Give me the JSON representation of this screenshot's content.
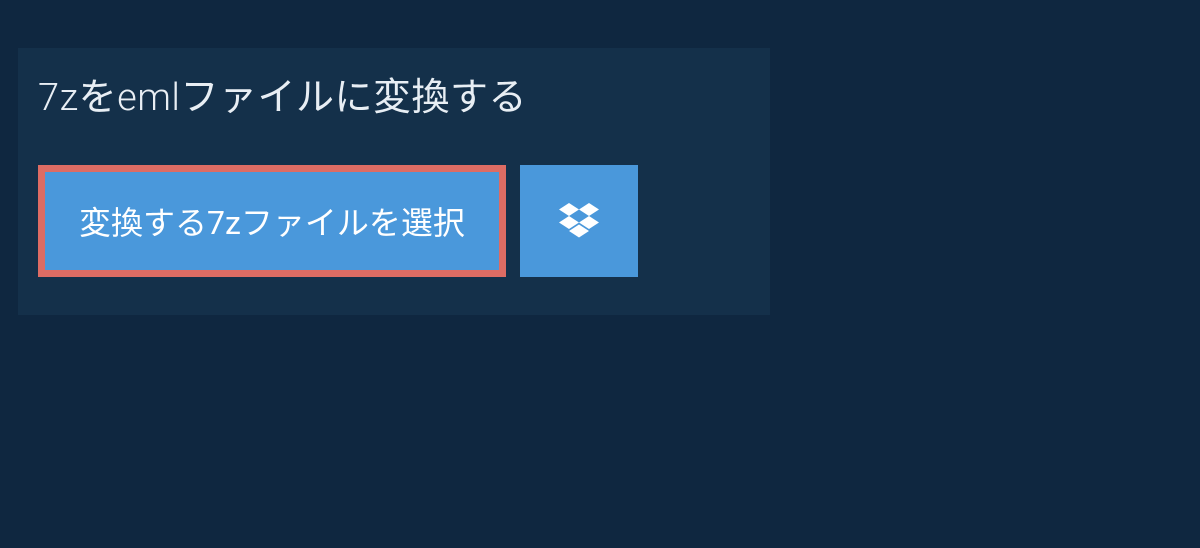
{
  "header": {
    "title": "7zをemlファイルに変換する"
  },
  "actions": {
    "select_file_label": "変換する7zファイルを選択"
  },
  "colors": {
    "background": "#0f2740",
    "panel": "#14304a",
    "button_primary": "#4a98db",
    "button_highlight_border": "#dd6c64",
    "text": "#e8eef4"
  }
}
